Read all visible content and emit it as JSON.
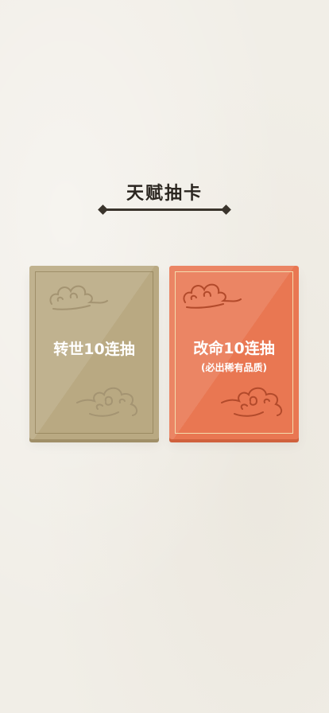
{
  "header": {
    "title": "天赋抽卡"
  },
  "cards": {
    "reincarnation": {
      "label": "转世10连抽"
    },
    "fate_change": {
      "label": "改命10连抽",
      "sublabel": "(必出稀有品质)"
    }
  },
  "colors": {
    "background": "#f1eee7",
    "reincarnation_card": "#b9a982",
    "fate_change_card": "#e97752",
    "title_text": "#2b2620"
  }
}
